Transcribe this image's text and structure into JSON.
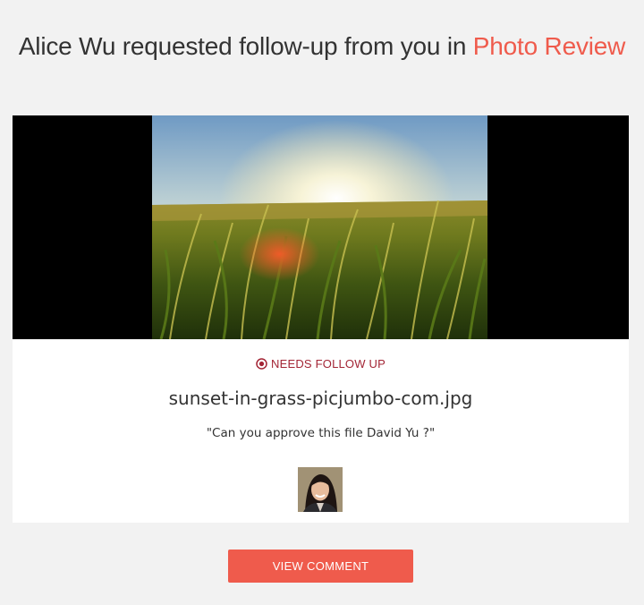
{
  "header": {
    "prefix": "Alice Wu requested follow-up from you in ",
    "project": "Photo Review"
  },
  "card": {
    "status_label": "NEEDS FOLLOW UP",
    "status_icon": "target-icon",
    "file_name": "sunset-in-grass-picjumbo-com.jpg",
    "comment": "\"Can you approve this file David Yu ?\""
  },
  "cta": {
    "label": "VIEW COMMENT"
  },
  "colors": {
    "accent": "#ef5b4c",
    "status": "#a32535",
    "background": "#f2f2f2",
    "card": "#ffffff"
  }
}
